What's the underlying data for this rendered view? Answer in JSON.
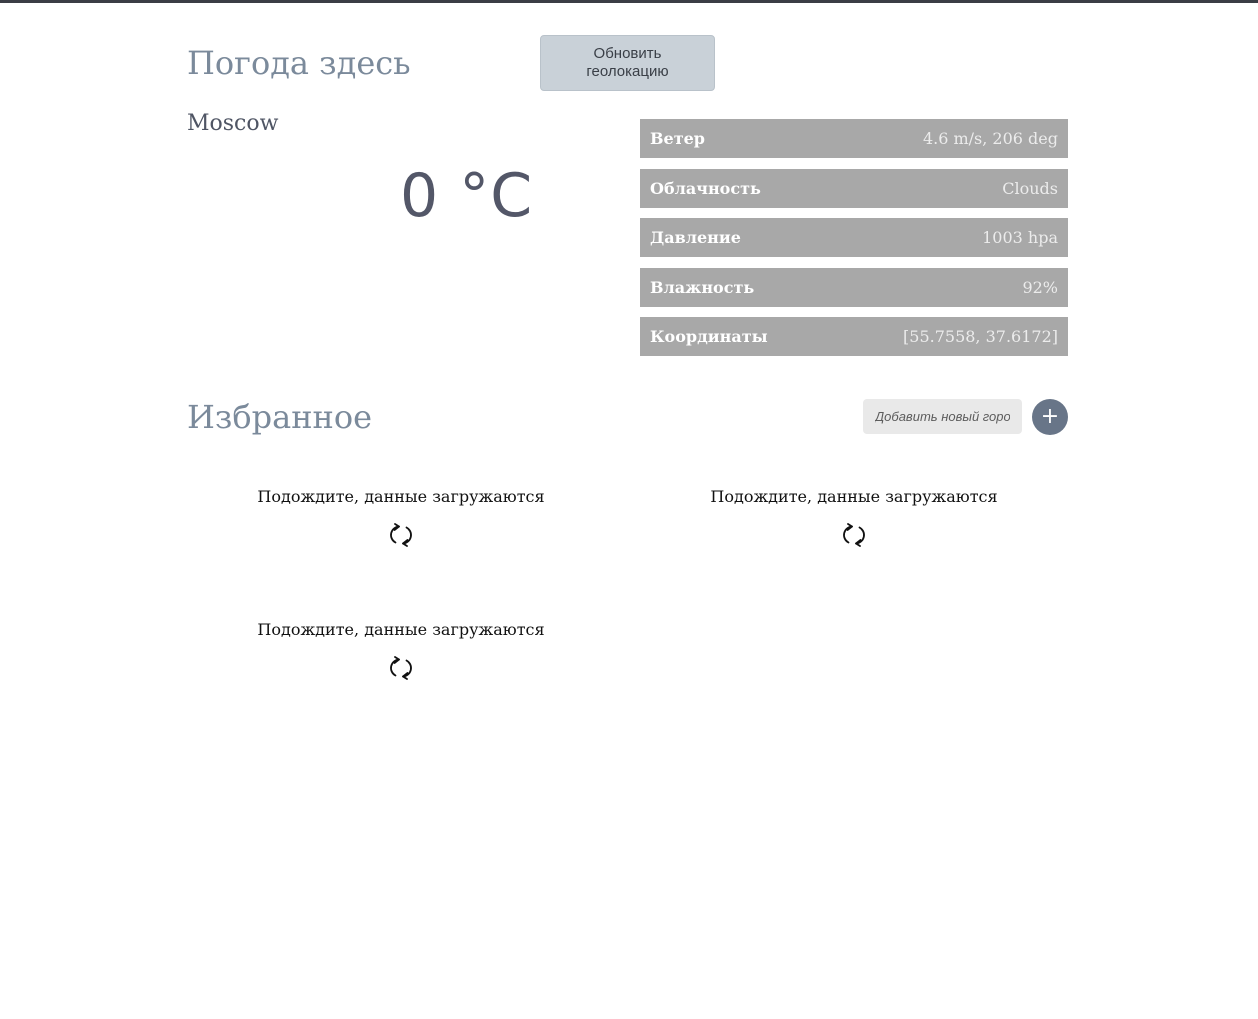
{
  "header": {
    "title": "Погода здесь",
    "refresh_button": "Обновить геолокацию"
  },
  "current": {
    "city": "Moscow",
    "temperature": "0 °C",
    "details": [
      {
        "label": "Ветер",
        "value": "4.6 m/s, 206 deg"
      },
      {
        "label": "Облачность",
        "value": "Clouds"
      },
      {
        "label": "Давление",
        "value": "1003 hpa"
      },
      {
        "label": "Влажность",
        "value": "92%"
      },
      {
        "label": "Координаты",
        "value": "[55.7558, 37.6172]"
      }
    ]
  },
  "favorites": {
    "title": "Избранное",
    "add_placeholder": "Добавить новый город",
    "add_button": "+",
    "cards": [
      {
        "message": "Подождите, данные загружаются",
        "icon": "refresh-icon"
      },
      {
        "message": "Подождите, данные загружаются",
        "icon": "refresh-icon"
      },
      {
        "message": "Подождите, данные загружаются",
        "icon": "refresh-icon"
      }
    ]
  },
  "colors": {
    "heading": "#7b8a9b",
    "info_row_bg": "#a8a8a8",
    "add_button_bg": "#687588",
    "refresh_button_bg": "#c9d1d8"
  }
}
